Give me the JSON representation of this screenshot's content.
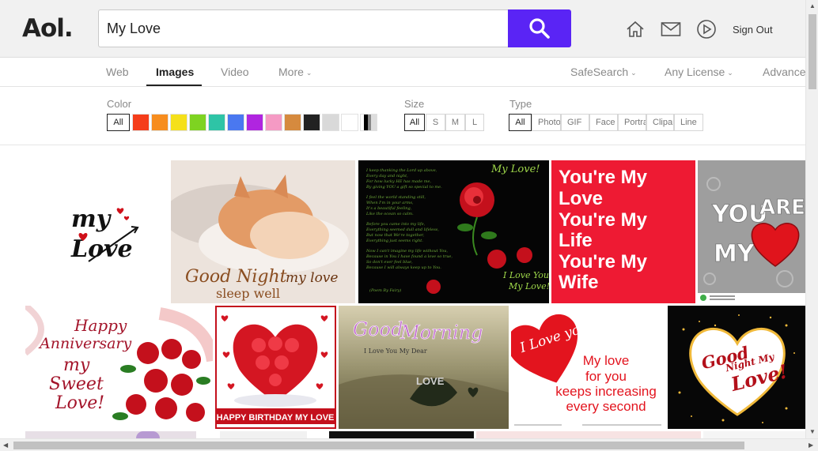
{
  "header": {
    "logo": "Aol.",
    "search_value": "My Love",
    "sign_out": "Sign Out",
    "icons": [
      "home-icon",
      "mail-icon",
      "play-icon",
      "search-icon"
    ],
    "accent_color": "#5a24f5"
  },
  "tabs": {
    "items": [
      {
        "label": "Web",
        "active": false
      },
      {
        "label": "Images",
        "active": true
      },
      {
        "label": "Video",
        "active": false
      },
      {
        "label": "More",
        "active": false
      }
    ],
    "right": [
      {
        "label": "SafeSearch"
      },
      {
        "label": "Any License"
      },
      {
        "label": "Advanced"
      }
    ]
  },
  "filters": {
    "color_label": "Color",
    "color_all": "All",
    "colors": [
      "#f53d1a",
      "#f78d1e",
      "#f5e01a",
      "#7ed321",
      "#2ec4a6",
      "#4a78f0",
      "#b025e0",
      "#f59ac4",
      "#d68a3e",
      "#222222",
      "#d9d9d9",
      "#ffffff"
    ],
    "size_label": "Size",
    "sizes": [
      "All",
      "S",
      "M",
      "L"
    ],
    "type_label": "Type",
    "types": [
      "All",
      "Photo",
      "GIF",
      "Face",
      "Portrait",
      "Clipart",
      "Line"
    ]
  },
  "images": {
    "tile_1": {
      "line1": "my",
      "line2": "Love"
    },
    "tile_2": {
      "line1": "Good Night",
      "line2": "my love",
      "line3": "sleep well"
    },
    "tile_3": {
      "title": "My Love!",
      "sign1": "I Love You",
      "sign2": "My Love!"
    },
    "tile_4": {
      "lines": [
        "You're My",
        "Love",
        "You're My",
        "Life",
        "You're My",
        "Wife"
      ]
    },
    "tile_5": {
      "line1": "YOU",
      "line2": "ARE",
      "line3": "MY"
    },
    "tile_6": {
      "line1": "Happy",
      "line2": "Anniversary",
      "line3": "my",
      "line4": "Sweet",
      "line5": "Love!"
    },
    "tile_7": {
      "banner": "HAPPY BIRTHDAY MY LOVE"
    },
    "tile_8": {
      "title1": "Good",
      "title2": "Morning",
      "sub": "I Love You My Dear",
      "leaf": "LOVE"
    },
    "tile_9": {
      "heart": "I Love you",
      "l1": "My love",
      "l2": "for you",
      "l3": "keeps increasing",
      "l4": "every second"
    },
    "tile_10": {
      "l1": "Good",
      "l2": "Night My",
      "l3": "Love!"
    }
  }
}
